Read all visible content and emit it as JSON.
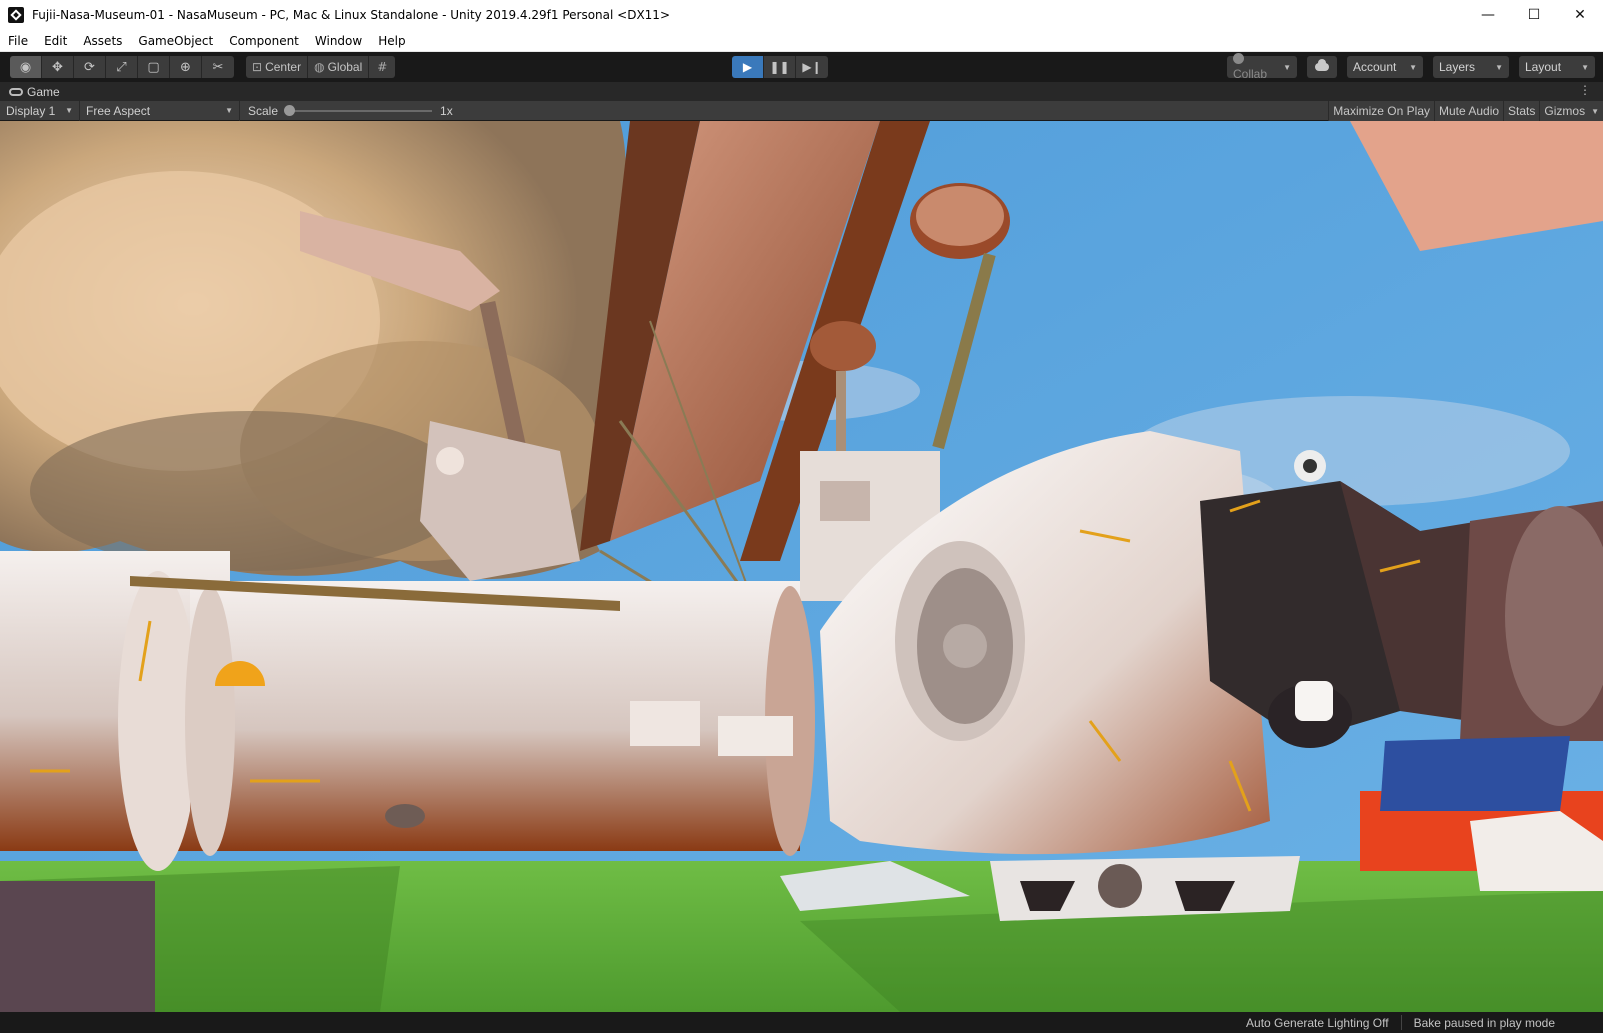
{
  "window": {
    "title": "Fujii-Nasa-Museum-01 - NasaMuseum - PC, Mac & Linux Standalone - Unity 2019.4.29f1 Personal <DX11>",
    "minimize_glyph": "—",
    "maximize_glyph": "☐",
    "close_glyph": "✕"
  },
  "menu": [
    "File",
    "Edit",
    "Assets",
    "GameObject",
    "Component",
    "Window",
    "Help"
  ],
  "toolbar": {
    "tools": [
      {
        "name": "view-tool",
        "glyph": "◉",
        "active": true
      },
      {
        "name": "move-tool",
        "glyph": "✥",
        "active": false
      },
      {
        "name": "rotate-tool",
        "glyph": "⟳",
        "active": false
      },
      {
        "name": "scale-tool",
        "glyph": "⤢",
        "active": false
      },
      {
        "name": "rect-tool",
        "glyph": "▢",
        "active": false
      },
      {
        "name": "transform-tool",
        "glyph": "⊕",
        "active": false
      },
      {
        "name": "custom-tool",
        "glyph": "✂",
        "active": false
      }
    ],
    "pivot_label": "Center",
    "space_label": "Global",
    "play": {
      "play_glyph": "▶",
      "pause_glyph": "❚❚",
      "step_glyph": "▶❙",
      "playing": true
    },
    "collab_label": "Collab",
    "account_label": "Account",
    "layers_label": "Layers",
    "layout_label": "Layout"
  },
  "game_view": {
    "tab_label": "Game",
    "display_label": "Display 1",
    "aspect_label": "Free Aspect",
    "scale_label": "Scale",
    "scale_value": "1x",
    "scale_fraction": 0.0,
    "maximize_label": "Maximize On Play",
    "mute_label": "Mute Audio",
    "stats_label": "Stats",
    "gizmos_label": "Gizmos"
  },
  "status": {
    "lighting": "Auto Generate Lighting Off",
    "bake": "Bake paused in play mode"
  },
  "colors": {
    "play_active": "#3a79bb",
    "toolbar_bg": "#191919",
    "button_bg": "#3c3c3c",
    "ground": "#5fae3a",
    "sky_top": "#3b8fd4"
  }
}
